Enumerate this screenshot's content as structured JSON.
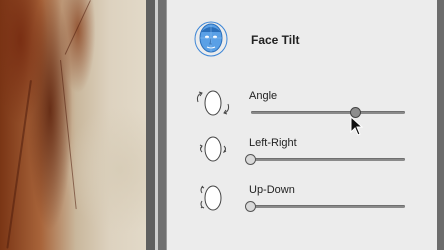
{
  "panel": {
    "title": "Face Tilt",
    "title_icon": "face-mesh-icon"
  },
  "sliders": [
    {
      "label": "Angle",
      "icon": "face-rotate-icon",
      "value": 0.68,
      "active": true
    },
    {
      "label": "Left-Right",
      "icon": "face-left-right-icon",
      "value": 0.0,
      "active": false
    },
    {
      "label": "Up-Down",
      "icon": "face-up-down-icon",
      "value": 0.0,
      "active": false
    }
  ],
  "colors": {
    "accent_blue": "#3d86d6",
    "panel_bg": "#ececec",
    "track": "#8a8a8a"
  }
}
